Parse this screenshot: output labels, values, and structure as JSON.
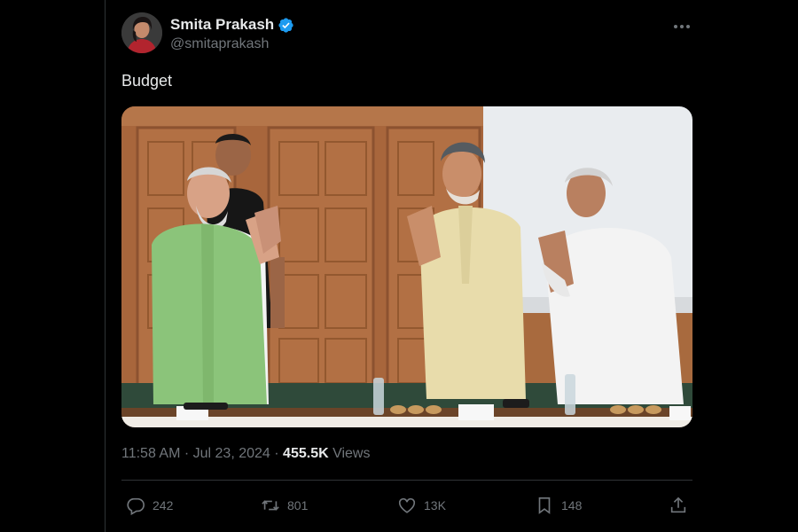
{
  "tweet": {
    "author": {
      "display_name": "Smita Prakash",
      "handle": "@smitaprakash",
      "verified": true
    },
    "text": "Budget",
    "timestamp": "11:58 AM · Jul 23, 2024",
    "separator": "·",
    "views": {
      "count": "455.5K",
      "label": "Views"
    },
    "actions": {
      "replies": "242",
      "reposts": "801",
      "likes": "13K",
      "bookmarks": "148"
    }
  },
  "icons": {
    "more": "more-horizontal-icon",
    "verified": "verified-badge-icon",
    "reply": "reply-icon",
    "repost": "repost-icon",
    "like": "heart-icon",
    "bookmark": "bookmark-icon",
    "share": "share-icon"
  },
  "colors": {
    "background": "#000000",
    "text": "#e7e9ea",
    "muted": "#71767b",
    "verified": "#1d9bf0",
    "divider": "#2f3336"
  }
}
